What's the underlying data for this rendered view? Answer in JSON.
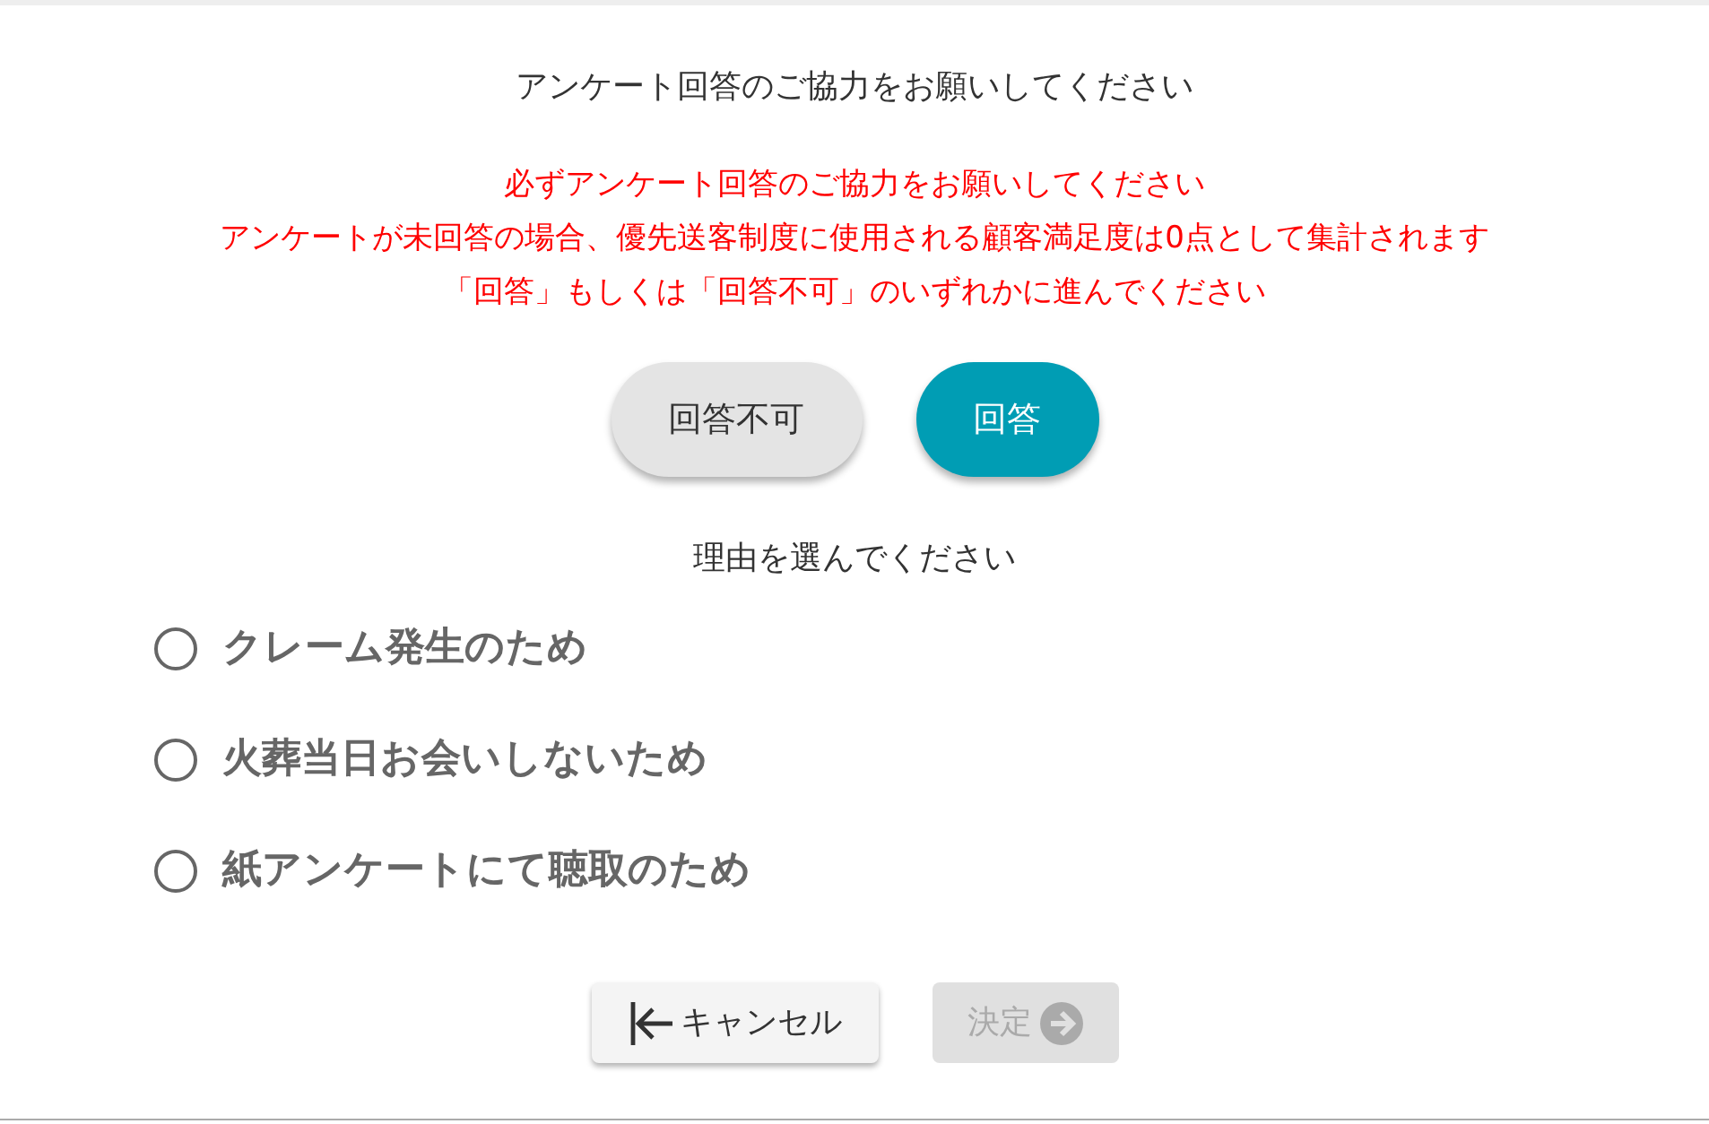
{
  "title": "アンケート回答のご協力をお願いしてください",
  "notices": [
    "必ずアンケート回答のご協力をお願いしてください",
    "アンケートが未回答の場合、優先送客制度に使用される顧客満足度は0点として集計されます",
    "「回答」もしくは「回答不可」のいずれかに進んでください"
  ],
  "choice_buttons": [
    {
      "label": "回答不可",
      "kind": "secondary"
    },
    {
      "label": "回答",
      "kind": "primary"
    }
  ],
  "reason_prompt": "理由を選んでください",
  "reasons": [
    {
      "label": "クレーム発生のため",
      "selected": false
    },
    {
      "label": "火葬当日お会いしないため",
      "selected": false
    },
    {
      "label": "紙アンケートにて聴取のため",
      "selected": false
    }
  ],
  "actions": [
    {
      "label": "キャンセル",
      "kind": "cancel",
      "disabled": false
    },
    {
      "label": "決定",
      "kind": "confirm",
      "disabled": true
    }
  ]
}
